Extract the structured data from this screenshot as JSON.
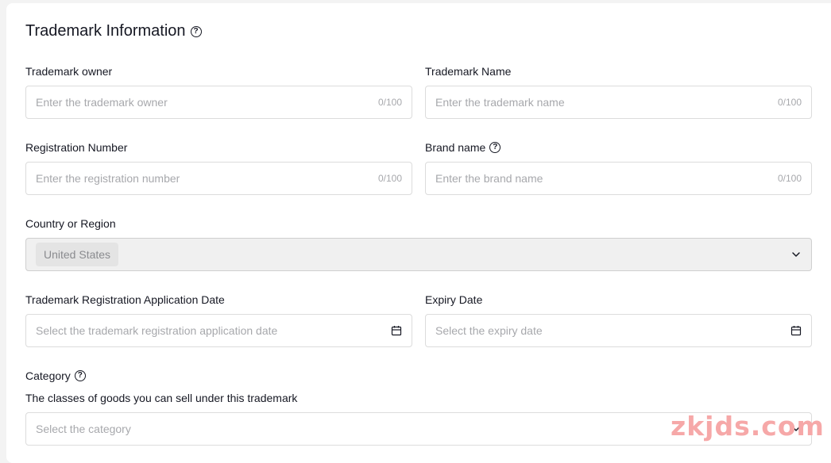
{
  "section": {
    "title": "Trademark Information",
    "help_glyph": "?"
  },
  "fields": {
    "trademark_owner": {
      "label": "Trademark owner",
      "placeholder": "Enter the trademark owner",
      "count": "0/100"
    },
    "trademark_name": {
      "label": "Trademark Name",
      "placeholder": "Enter the trademark name",
      "count": "0/100"
    },
    "registration_number": {
      "label": "Registration Number",
      "placeholder": "Enter the registration number",
      "count": "0/100"
    },
    "brand_name": {
      "label": "Brand name",
      "placeholder": "Enter the brand name",
      "count": "0/100",
      "help_icon": "question-circle-icon"
    },
    "country": {
      "label": "Country or Region",
      "value": "United States",
      "icon": "chevron-down-icon"
    },
    "application_date": {
      "label": "Trademark Registration Application Date",
      "placeholder": "Select the trademark registration application date",
      "icon": "calendar-icon"
    },
    "expiry_date": {
      "label": "Expiry Date",
      "placeholder": "Select the expiry date",
      "icon": "calendar-icon"
    },
    "category": {
      "label": "Category",
      "description": "The classes of goods you can sell under this trademark",
      "placeholder": "Select the category",
      "help_icon": "question-circle-icon",
      "icon": "chevron-down-icon"
    }
  },
  "watermark": "zkjds.com",
  "colors": {
    "placeholder": "#a7a8ac",
    "border": "#dcdcdc",
    "disabled_bg": "#f0f0f0",
    "watermark": "#f6a8a8"
  }
}
